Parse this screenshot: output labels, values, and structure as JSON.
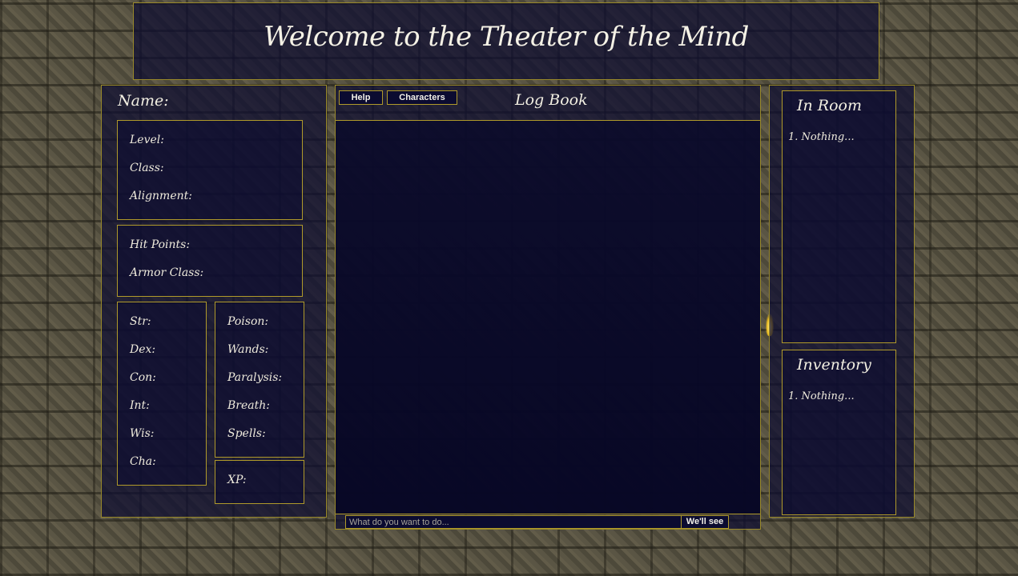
{
  "header": {
    "title": "Welcome to the Theater of the Mind"
  },
  "character": {
    "name_label": "Name:",
    "level_label": "Level:",
    "class_label": "Class:",
    "alignment_label": "Alignment:",
    "hp_label": "Hit Points:",
    "ac_label": "Armor Class:",
    "stats": [
      "Str:",
      "Dex:",
      "Con:",
      "Int:",
      "Wis:",
      "Cha:"
    ],
    "saves": [
      "Poison:",
      "Wands:",
      "Paralysis:",
      "Breath:",
      "Spells:"
    ],
    "xp_label": "XP:"
  },
  "log": {
    "help_label": "Help",
    "characters_label": "Characters",
    "title": "Log Book",
    "input_placeholder": "What do you want to do...",
    "submit_label": "We'll see"
  },
  "room": {
    "title": "In Room",
    "items": [
      "1. Nothing..."
    ]
  },
  "inventory": {
    "title": "Inventory",
    "items": [
      "1. Nothing..."
    ]
  },
  "colors": {
    "accent": "#b09a2a",
    "panel": "#0c0c30",
    "text": "#f0ede0"
  }
}
